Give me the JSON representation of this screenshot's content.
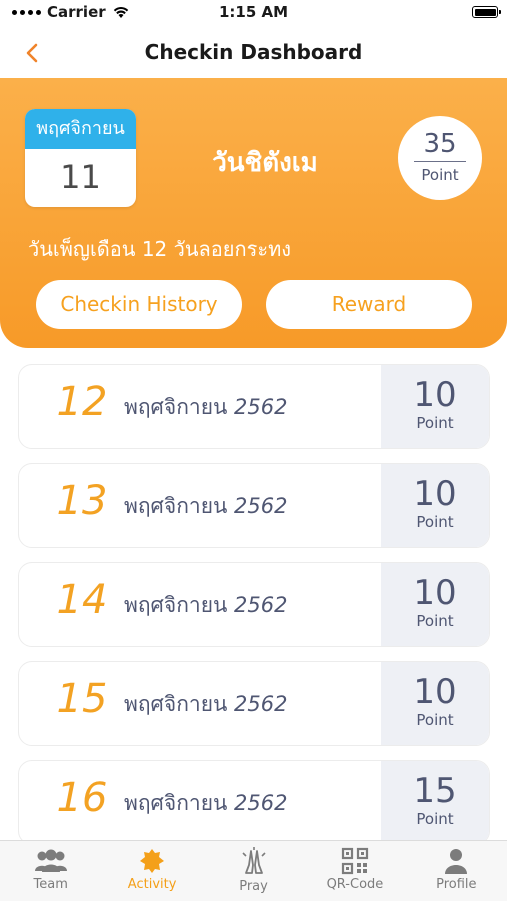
{
  "status_bar": {
    "carrier": "Carrier",
    "time": "1:15 AM"
  },
  "nav": {
    "title": "Checkin Dashboard",
    "back_icon": "chevron-left-icon"
  },
  "header": {
    "calendar_month": "พฤศจิกายน",
    "calendar_day": "11",
    "day_name": "วันชิตังเม",
    "points_value": "35",
    "points_unit": "Point",
    "subtitle": "วันเพ็ญเดือน 12 วันลอยกระทง",
    "history_button": "Checkin History",
    "reward_button": "Reward"
  },
  "checkins": [
    {
      "day": "12",
      "month": "พฤศจิกายน",
      "year": "2562",
      "points": "10",
      "unit": "Point"
    },
    {
      "day": "13",
      "month": "พฤศจิกายน",
      "year": "2562",
      "points": "10",
      "unit": "Point"
    },
    {
      "day": "14",
      "month": "พฤศจิกายน",
      "year": "2562",
      "points": "10",
      "unit": "Point"
    },
    {
      "day": "15",
      "month": "พฤศจิกายน",
      "year": "2562",
      "points": "10",
      "unit": "Point"
    },
    {
      "day": "16",
      "month": "พฤศจิกายน",
      "year": "2562",
      "points": "15",
      "unit": "Point"
    }
  ],
  "tabs": [
    {
      "label": "Team",
      "icon": "team-icon"
    },
    {
      "label": "Activity",
      "icon": "activity-icon",
      "active": true
    },
    {
      "label": "Pray",
      "icon": "pray-icon"
    },
    {
      "label": "QR-Code",
      "icon": "qr-code-icon"
    },
    {
      "label": "Profile",
      "icon": "profile-icon"
    }
  ],
  "colors": {
    "accent": "#f4a01a",
    "header_gradient_top": "#fbb04a",
    "header_gradient_bottom": "#f79a28",
    "calendar_blue": "#2fb1ea",
    "text_slate": "#4f5672"
  }
}
